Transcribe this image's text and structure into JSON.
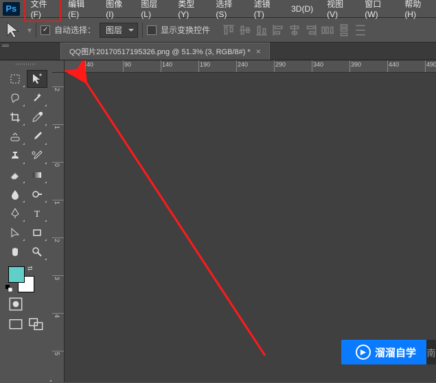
{
  "app": {
    "logo": "Ps"
  },
  "menu": [
    {
      "label": "文件(F)",
      "highlight": true
    },
    {
      "label": "编辑(E)"
    },
    {
      "label": "图像(I)"
    },
    {
      "label": "图层(L)"
    },
    {
      "label": "类型(Y)"
    },
    {
      "label": "选择(S)"
    },
    {
      "label": "滤镜(T)"
    },
    {
      "label": "3D(D)"
    },
    {
      "label": "视图(V)"
    },
    {
      "label": "窗口(W)"
    },
    {
      "label": "帮助(H)"
    }
  ],
  "options": {
    "auto_select_label": "自动选择：",
    "auto_select_checked": true,
    "scope_value": "图层",
    "show_transform_checked": false,
    "show_transform_label": "显示变换控件"
  },
  "document": {
    "tab_title": "QQ图片20170517195326.png @ 51.3% (3, RGB/8#) *"
  },
  "rulers": {
    "h_ticks": [
      "40",
      "90",
      "140",
      "190",
      "240",
      "290",
      "340",
      "390",
      "440",
      "490"
    ],
    "v_ticks": [
      "2",
      "1",
      "0",
      "1",
      "2",
      "3",
      "4",
      "5"
    ]
  },
  "swatch": {
    "fg": "#61cfc9"
  },
  "watermark": {
    "text": "溜溜自学",
    "tail": "南"
  }
}
